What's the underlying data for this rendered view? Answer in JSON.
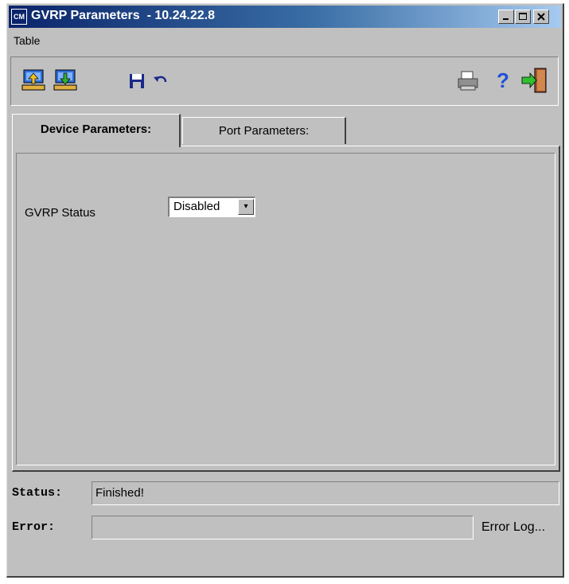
{
  "window": {
    "title": "GVRP Parameters  - 10.24.22.8",
    "app_icon_text": "CM",
    "controls": {
      "minimize": "_",
      "maximize": "□",
      "close": "×"
    }
  },
  "menubar": {
    "items": [
      "Table"
    ]
  },
  "toolbar": {
    "tools": [
      {
        "name": "upload-to-device-icon"
      },
      {
        "name": "download-from-device-icon"
      },
      {
        "name": "save-icon"
      },
      {
        "name": "undo-icon"
      },
      {
        "name": "print-icon"
      },
      {
        "name": "help-icon"
      },
      {
        "name": "exit-icon"
      }
    ]
  },
  "tabs": [
    {
      "label": "Device Parameters:",
      "active": true
    },
    {
      "label": "Port Parameters:",
      "active": false
    }
  ],
  "device_params": {
    "gvrp_label": "GVRP Status",
    "gvrp_value": "Disabled",
    "dropdown_arrow": "▾"
  },
  "status": {
    "label": "Status:",
    "value": "Finished!"
  },
  "error": {
    "label": "Error:",
    "value": "",
    "log_link": "Error Log..."
  },
  "colors": {
    "chrome": "#c0c0c0",
    "title_start": "#0a246a",
    "title_end": "#a6caf0"
  }
}
